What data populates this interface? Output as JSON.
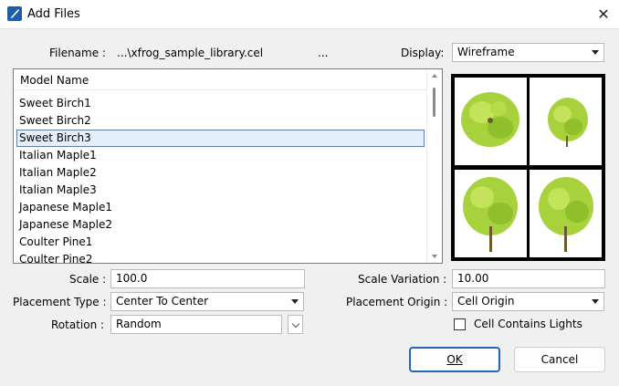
{
  "window": {
    "title": "Add Files",
    "close_icon": "close-icon",
    "app_icon": "bentley-app-icon"
  },
  "file": {
    "label": "Filename :",
    "value": "...\\xfrog_sample_library.cel",
    "browse_label": "..."
  },
  "display": {
    "label": "Display:",
    "value": "Wireframe"
  },
  "model_list": {
    "header": "Model Name",
    "items": [
      {
        "label": "Sweet Birch1",
        "selected": false
      },
      {
        "label": "Sweet Birch2",
        "selected": false
      },
      {
        "label": "Sweet Birch3",
        "selected": true
      },
      {
        "label": "Italian Maple1",
        "selected": false
      },
      {
        "label": "Italian Maple2",
        "selected": false
      },
      {
        "label": "Italian Maple3",
        "selected": false
      },
      {
        "label": "Japanese Maple1",
        "selected": false
      },
      {
        "label": "Japanese Maple2",
        "selected": false
      },
      {
        "label": "Coulter Pine1",
        "selected": false
      },
      {
        "label": "Coulter Pine2",
        "selected": false
      }
    ]
  },
  "preview": {
    "views": [
      "top-view",
      "top-view-small",
      "front-view",
      "side-view"
    ],
    "foliage_color": "#a8d23c",
    "trunk_color": "#6b5a2e"
  },
  "scale": {
    "label": "Scale :",
    "value": "100.0"
  },
  "scale_variation": {
    "label": "Scale Variation :",
    "value": "10.00"
  },
  "placement_type": {
    "label": "Placement Type :",
    "value": "Center To Center"
  },
  "placement_origin": {
    "label": "Placement Origin :",
    "value": "Cell Origin"
  },
  "rotation": {
    "label": "Rotation :",
    "value": "Random"
  },
  "cell_lights": {
    "label": "Cell Contains Lights",
    "checked": false
  },
  "buttons": {
    "ok_label": "OK",
    "cancel_label": "Cancel"
  },
  "colors": {
    "selection_bg": "#e5eef9",
    "selection_border": "#5c7fb3",
    "default_button_border": "#2267b8"
  }
}
